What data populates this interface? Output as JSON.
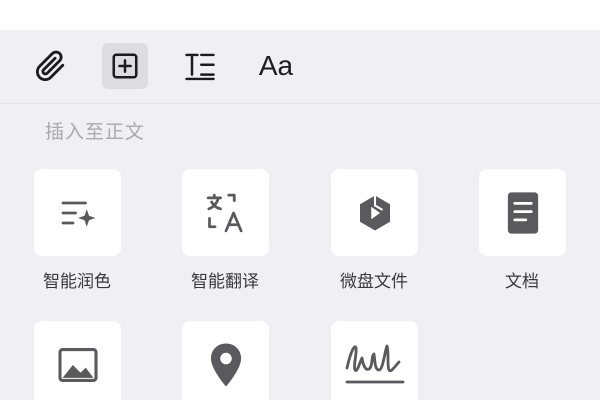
{
  "toolbar": {
    "attach_icon": "paperclip-icon",
    "insert_icon": "plus-square-icon",
    "format_icon": "text-format-icon",
    "font_label": "Aa"
  },
  "section": {
    "label": "插入至正文"
  },
  "grid": {
    "items": [
      {
        "label": "智能润色",
        "icon": "sparkle-lines-icon"
      },
      {
        "label": "智能翻译",
        "icon": "translate-icon"
      },
      {
        "label": "微盘文件",
        "icon": "cloud-disk-icon"
      },
      {
        "label": "文档",
        "icon": "document-icon"
      },
      {
        "label": "",
        "icon": "image-icon"
      },
      {
        "label": "",
        "icon": "location-pin-icon"
      },
      {
        "label": "",
        "icon": "signature-icon"
      }
    ]
  },
  "colors": {
    "panel_bg": "#efeff4",
    "tile_bg": "#ffffff",
    "icon": "#5a5a5e",
    "label": "#3a3a3c",
    "section_label": "#a9a9ae"
  }
}
